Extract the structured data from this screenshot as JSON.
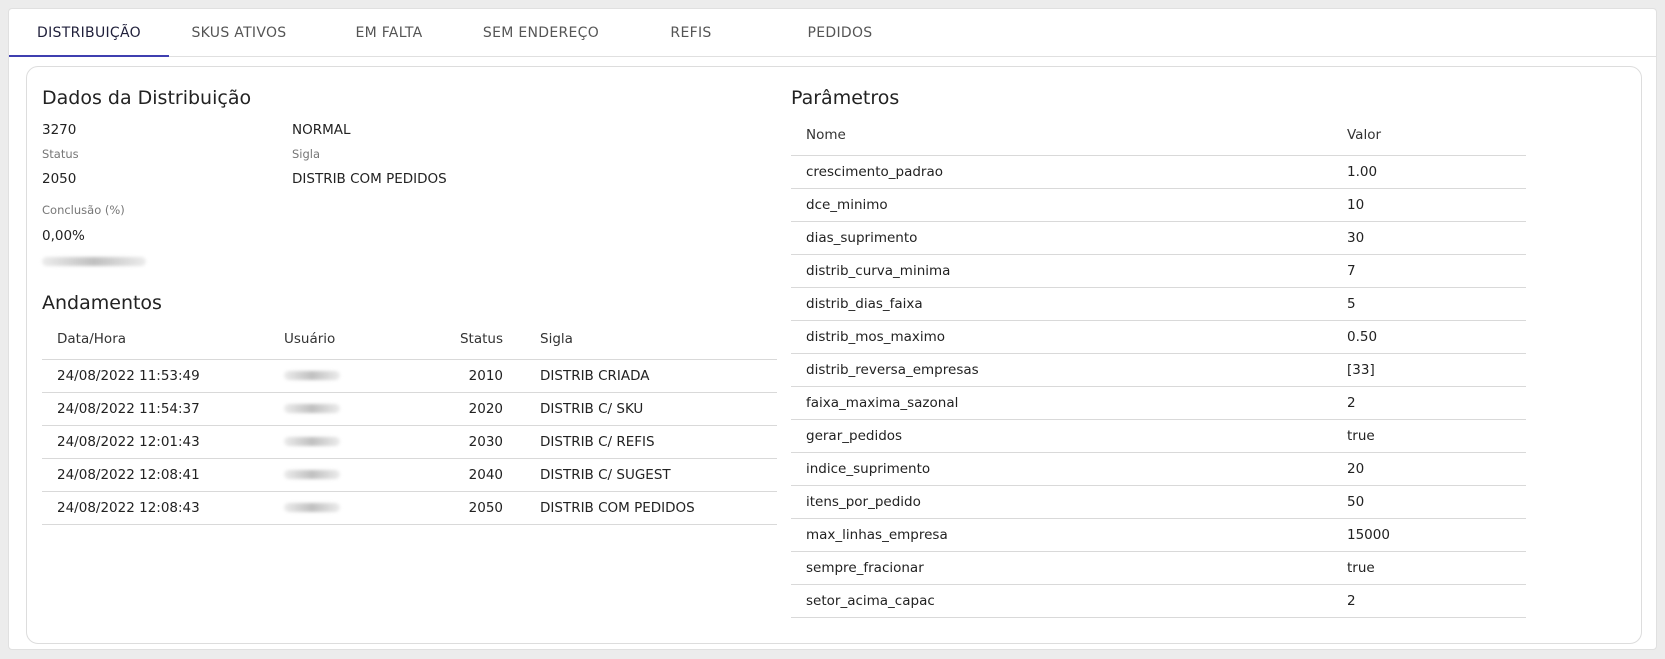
{
  "tabs": [
    "DISTRIBUIÇÃO",
    "SKUS ATIVOS",
    "EM FALTA",
    "SEM ENDEREÇO",
    "REFIS",
    "PEDIDOS"
  ],
  "dados": {
    "title": "Dados da Distribuição",
    "id": "3270",
    "tipo": "NORMAL",
    "status_label": "Status",
    "status_value": "2050",
    "sigla_label": "Sigla",
    "sigla_value": "DISTRIB COM PEDIDOS",
    "conclusao_label": "Conclusão (%)",
    "conclusao_value": "0,00%"
  },
  "andamentos": {
    "title": "Andamentos",
    "headers": {
      "datahora": "Data/Hora",
      "usuario": "Usuário",
      "status": "Status",
      "sigla": "Sigla"
    },
    "rows": [
      {
        "datahora": "24/08/2022 11:53:49",
        "status": "2010",
        "sigla": "DISTRIB CRIADA"
      },
      {
        "datahora": "24/08/2022 11:54:37",
        "status": "2020",
        "sigla": "DISTRIB C/ SKU"
      },
      {
        "datahora": "24/08/2022 12:01:43",
        "status": "2030",
        "sigla": "DISTRIB C/ REFIS"
      },
      {
        "datahora": "24/08/2022 12:08:41",
        "status": "2040",
        "sigla": "DISTRIB C/ SUGEST"
      },
      {
        "datahora": "24/08/2022 12:08:43",
        "status": "2050",
        "sigla": "DISTRIB COM PEDIDOS"
      }
    ]
  },
  "parametros": {
    "title": "Parâmetros",
    "headers": {
      "nome": "Nome",
      "valor": "Valor"
    },
    "rows": [
      {
        "nome": "crescimento_padrao",
        "valor": "1.00"
      },
      {
        "nome": "dce_minimo",
        "valor": "10"
      },
      {
        "nome": "dias_suprimento",
        "valor": "30"
      },
      {
        "nome": "distrib_curva_minima",
        "valor": "7"
      },
      {
        "nome": "distrib_dias_faixa",
        "valor": "5"
      },
      {
        "nome": "distrib_mos_maximo",
        "valor": "0.50"
      },
      {
        "nome": "distrib_reversa_empresas",
        "valor": "[33]"
      },
      {
        "nome": "faixa_maxima_sazonal",
        "valor": "2"
      },
      {
        "nome": "gerar_pedidos",
        "valor": "true"
      },
      {
        "nome": "indice_suprimento",
        "valor": "20"
      },
      {
        "nome": "itens_por_pedido",
        "valor": "50"
      },
      {
        "nome": "max_linhas_empresa",
        "valor": "15000"
      },
      {
        "nome": "sempre_fracionar",
        "valor": "true"
      },
      {
        "nome": "setor_acima_capac",
        "valor": "2"
      }
    ]
  },
  "colors": {
    "tab_indicator": "#3f3fb0",
    "divider": "#d9d9d9"
  }
}
